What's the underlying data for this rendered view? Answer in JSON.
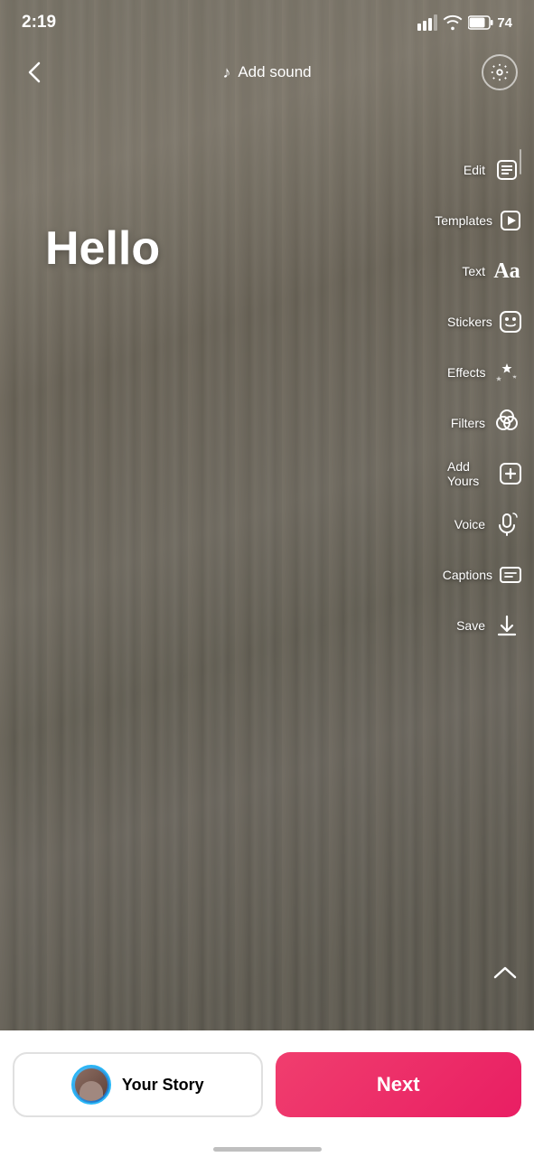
{
  "statusBar": {
    "time": "2:19",
    "battery": "74"
  },
  "topBar": {
    "addSound": "Add sound",
    "backIcon": "‹",
    "settingsIcon": "⚙"
  },
  "mainText": {
    "hello": "Hello"
  },
  "toolbar": {
    "items": [
      {
        "id": "edit",
        "label": "Edit",
        "icon": "edit"
      },
      {
        "id": "templates",
        "label": "Templates",
        "icon": "templates"
      },
      {
        "id": "text",
        "label": "Text",
        "icon": "text"
      },
      {
        "id": "stickers",
        "label": "Stickers",
        "icon": "stickers"
      },
      {
        "id": "effects",
        "label": "Effects",
        "icon": "effects"
      },
      {
        "id": "filters",
        "label": "Filters",
        "icon": "filters"
      },
      {
        "id": "addyours",
        "label": "Add Yours",
        "icon": "addyours"
      },
      {
        "id": "voice",
        "label": "Voice",
        "icon": "voice"
      },
      {
        "id": "captions",
        "label": "Captions",
        "icon": "captions"
      },
      {
        "id": "save",
        "label": "Save",
        "icon": "save"
      }
    ]
  },
  "bottomBar": {
    "yourStory": "Your Story",
    "next": "Next"
  }
}
